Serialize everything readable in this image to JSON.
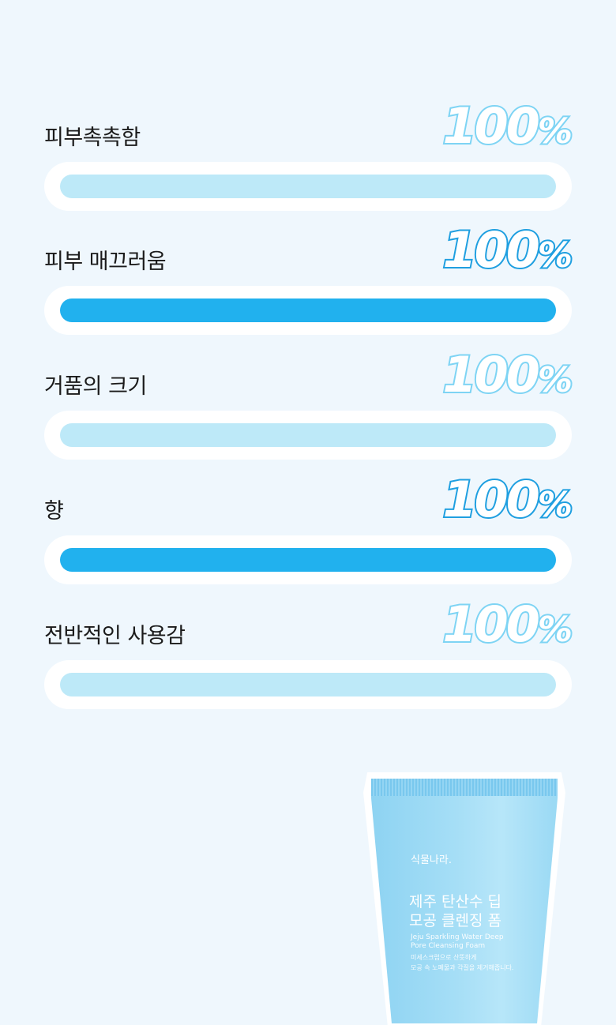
{
  "metrics": [
    {
      "label": "피부촉촉함",
      "percent": "100",
      "percent_symbol": "%",
      "value": 100,
      "style": "light"
    },
    {
      "label": "피부 매끄러움",
      "percent": "100",
      "percent_symbol": "%",
      "value": 100,
      "style": "strong"
    },
    {
      "label": "거품의 크기",
      "percent": "100",
      "percent_symbol": "%",
      "value": 100,
      "style": "light"
    },
    {
      "label": "향",
      "percent": "100",
      "percent_symbol": "%",
      "value": 100,
      "style": "strong"
    },
    {
      "label": "전반적인 사용감",
      "percent": "100",
      "percent_symbol": "%",
      "value": 100,
      "style": "light"
    }
  ],
  "product": {
    "brand": "식물나라.",
    "name_ko_line1": "제주 탄산수 딥",
    "name_ko_line2": "모공 클렌징 폼",
    "name_en_line1": "Jeju Sparkling Water Deep",
    "name_en_line2": "Pore Cleansing Foam",
    "desc_line1": "미세스크럽으로 산뜻하게",
    "desc_line2": "모공 속 노폐물과 각질을 제거해줍니다."
  },
  "colors": {
    "background": "#eff7fd",
    "bar_light": "#bde9f8",
    "bar_strong": "#21b1ee",
    "track": "#ffffff",
    "percent_outline_light": "#7ed4f4",
    "percent_outline_strong": "#1f9fe0"
  }
}
